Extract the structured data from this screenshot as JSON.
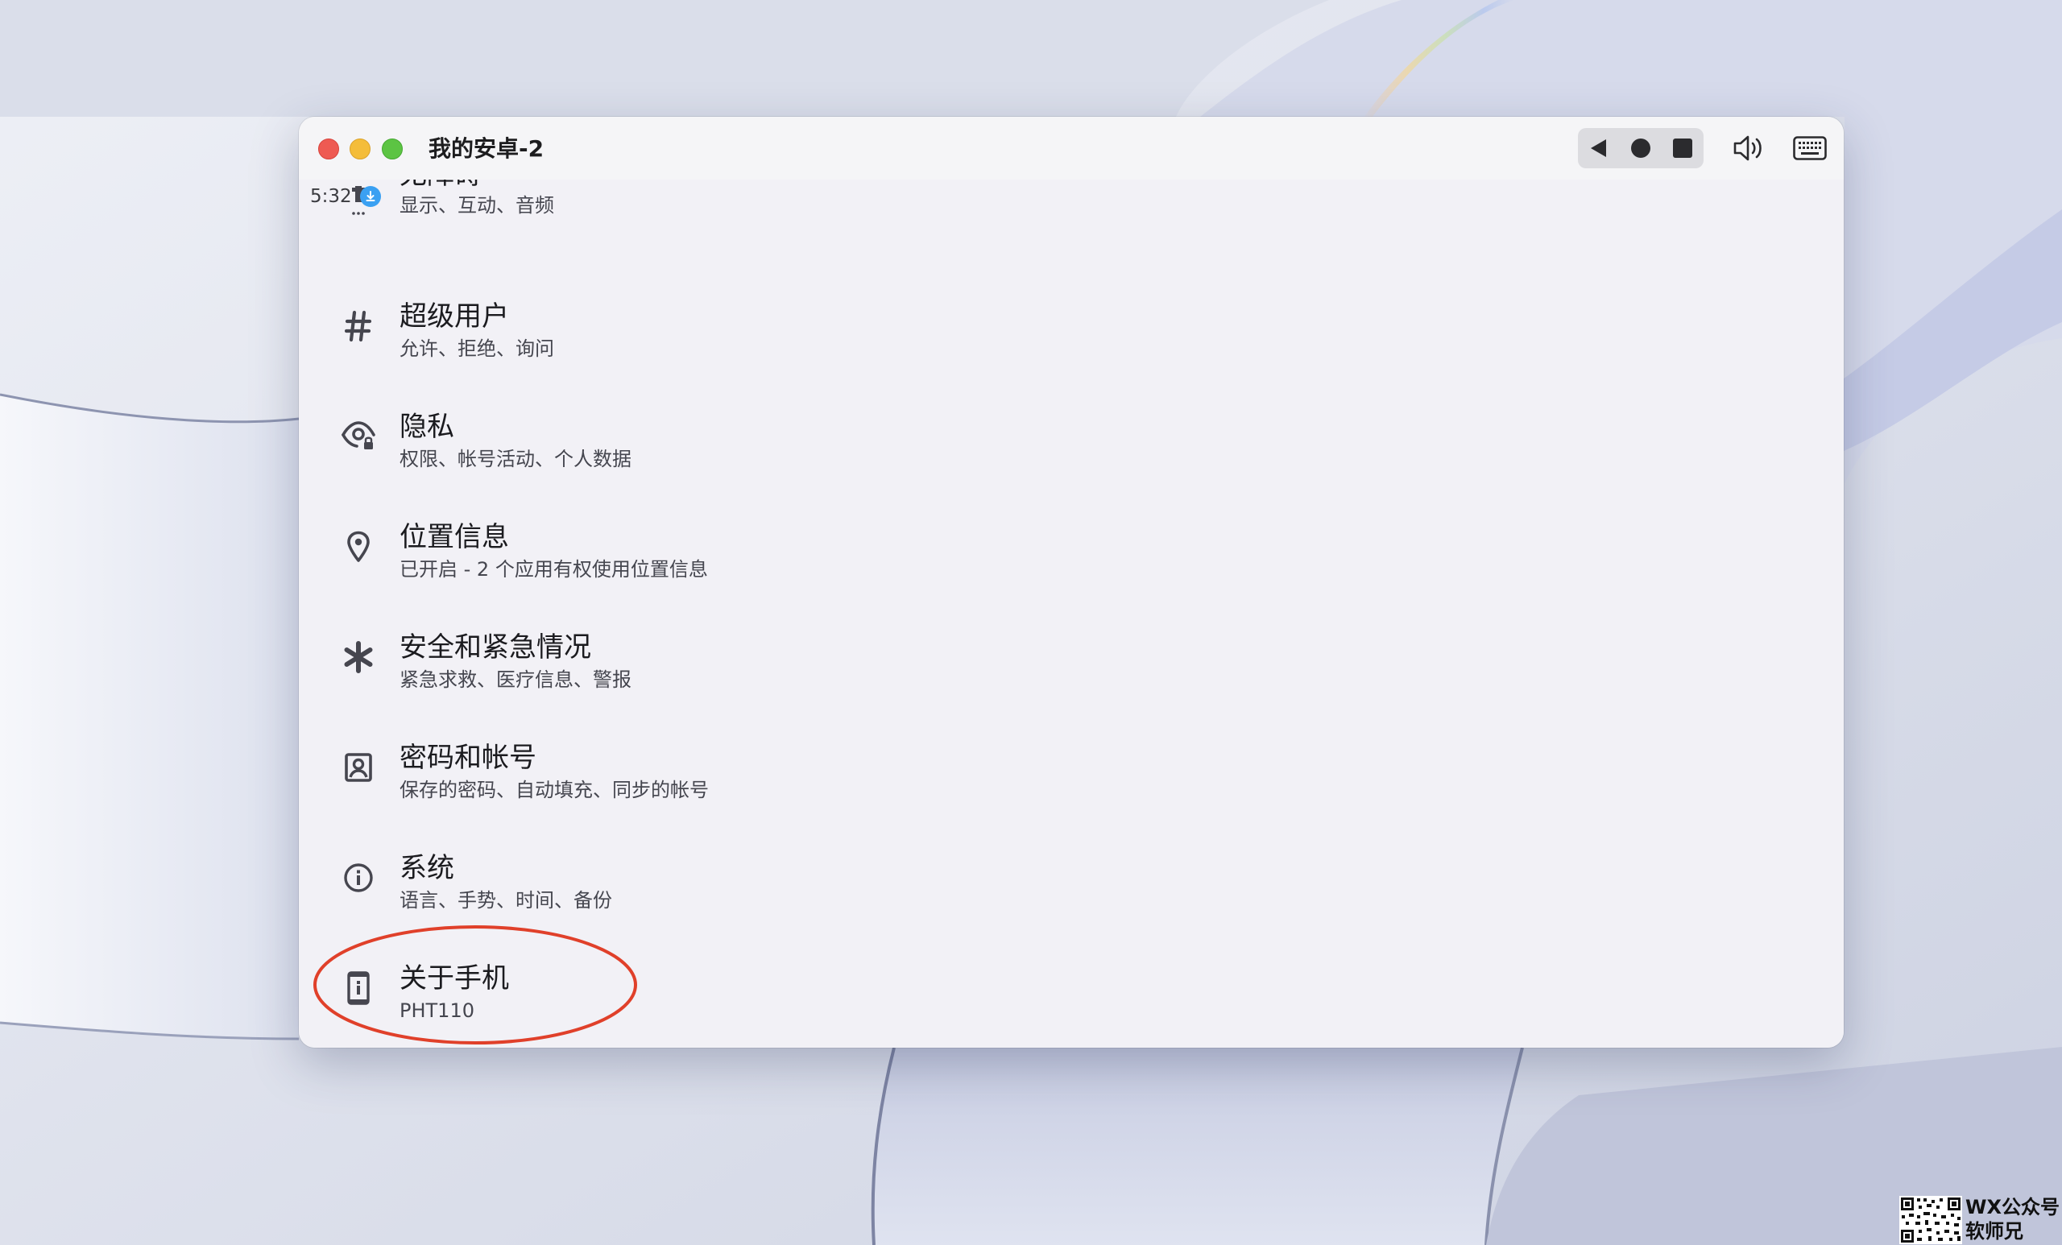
{
  "window": {
    "title": "我的安卓-2"
  },
  "status_bar": {
    "time": "5:32",
    "notification_icon": "download-icon"
  },
  "toolbar": {
    "back_icon": "back-triangle-icon",
    "home_icon": "home-circle-icon",
    "recent_icon": "recent-square-icon",
    "volume_icon": "volume-icon",
    "keyboard_icon": "keyboard-icon"
  },
  "settings": {
    "partial": {
      "title": "无障碍",
      "subtitle": "显示、互动、音频",
      "icon": "accessibility-icon"
    },
    "items": [
      {
        "title": "超级用户",
        "subtitle": "允许、拒绝、询问",
        "icon": "hash-icon"
      },
      {
        "title": "隐私",
        "subtitle": "权限、帐号活动、个人数据",
        "icon": "privacy-eye-icon"
      },
      {
        "title": "位置信息",
        "subtitle": "已开启 - 2 个应用有权使用位置信息",
        "icon": "location-pin-icon"
      },
      {
        "title": "安全和紧急情况",
        "subtitle": "紧急求救、医疗信息、警报",
        "icon": "asterisk-icon"
      },
      {
        "title": "密码和帐号",
        "subtitle": "保存的密码、自动填充、同步的帐号",
        "icon": "account-box-icon"
      },
      {
        "title": "系统",
        "subtitle": "语言、手势、时间、备份",
        "icon": "info-circle-icon"
      },
      {
        "title": "关于手机",
        "subtitle": "PHT110",
        "icon": "phone-info-icon"
      }
    ]
  },
  "annotation": {
    "highlight_color": "#e0402a"
  },
  "watermark": {
    "line1": "WX公众号",
    "line2": "软师兄"
  }
}
